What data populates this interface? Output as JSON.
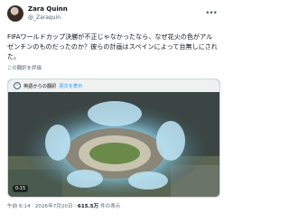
{
  "author": {
    "display_name": "Zara Quinn",
    "handle": "@_Zaraquin"
  },
  "more_icon": "more-horizontal-icon",
  "tweet": {
    "text": "FIFAワールドカップ決勝が不正じゃなかったなら、なぜ花火の色がアルゼンチンのものだったのか？彼らの計画はスペインによって台無しにされた。",
    "translate_label": "この翻訳を評価"
  },
  "media": {
    "notice_text": "英語からの翻訳",
    "notice_link": "原文を表示",
    "duration": "0:15"
  },
  "meta": {
    "time": "午前 6:14",
    "date": "2026年7月20日",
    "views_count": "615.5万",
    "views_label": "件の表示"
  },
  "colors": {
    "link": "#1d9bf0",
    "text": "#0f1419",
    "secondary": "#536471"
  }
}
